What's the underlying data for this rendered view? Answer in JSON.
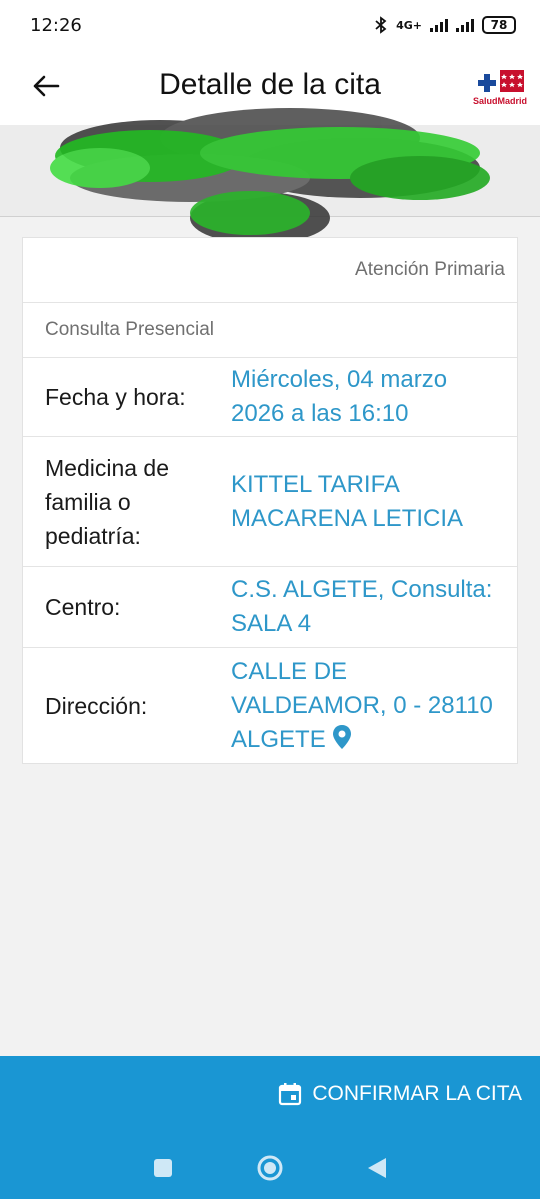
{
  "status_bar": {
    "time": "12:26",
    "network": "4G+",
    "battery": "78"
  },
  "header": {
    "title": "Detalle de la cita",
    "logo_text": "SaludMadrid"
  },
  "card": {
    "care_level": "Atención Primaria",
    "consult_type": "Consulta Presencial",
    "rows": [
      {
        "label": "Fecha y hora:",
        "value": "Miércoles, 04 marzo 2026 a las 16:10"
      },
      {
        "label": "Medicina de familia o pediatría:",
        "value": "KITTEL TARIFA MACARENA LETICIA"
      },
      {
        "label": "Centro:",
        "value": "C.S. ALGETE, Consulta: SALA 4"
      },
      {
        "label": "Dirección:",
        "value": "CALLE DE VALDEAMOR, 0 - 28110 ALGETE"
      }
    ]
  },
  "actions": {
    "confirm_label": "CONFIRMAR LA CITA"
  },
  "colors": {
    "accent": "#2e97c9",
    "action_bar": "#1a96d3",
    "brand_red": "#c8102e"
  },
  "icons": {
    "back": "arrow-left-icon",
    "calendar": "calendar-icon",
    "location": "map-pin-icon",
    "bluetooth": "bluetooth-icon"
  }
}
